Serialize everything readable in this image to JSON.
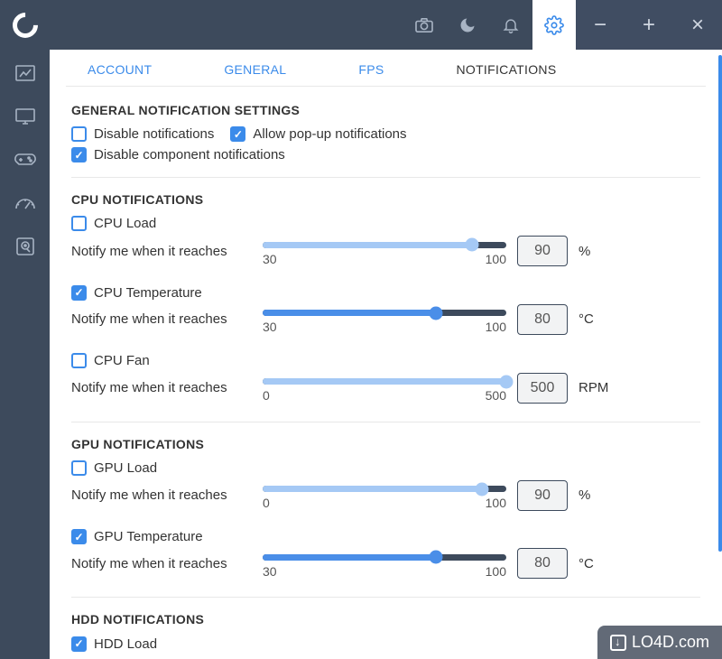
{
  "topbar": {
    "icons": [
      "camera-icon",
      "moon-icon",
      "bell-icon",
      "settings-icon"
    ]
  },
  "sidebar": {
    "icons": [
      "dashboard-icon",
      "monitor-icon",
      "gamepad-icon",
      "gauge-icon",
      "disk-icon"
    ]
  },
  "tabs": [
    {
      "label": "ACCOUNT",
      "active": false
    },
    {
      "label": "GENERAL",
      "active": false
    },
    {
      "label": "FPS",
      "active": false
    },
    {
      "label": "NOTIFICATIONS",
      "active": true
    }
  ],
  "sections": {
    "general": {
      "heading": "GENERAL NOTIFICATION SETTINGS",
      "checks": [
        {
          "label": "Disable notifications",
          "checked": false
        },
        {
          "label": "Allow pop-up notifications",
          "checked": true
        },
        {
          "label": "Disable component notifications",
          "checked": true
        }
      ]
    },
    "cpu": {
      "heading": "CPU NOTIFICATIONS",
      "items": [
        {
          "label": "CPU Load",
          "checked": false,
          "notify": "Notify me when it reaches",
          "min": "30",
          "max": "100",
          "value": "90",
          "unit": "%",
          "fill": 86,
          "mode": "light"
        },
        {
          "label": "CPU Temperature",
          "checked": true,
          "notify": "Notify me when it reaches",
          "min": "30",
          "max": "100",
          "value": "80",
          "unit": "°C",
          "fill": 71,
          "mode": "blue"
        },
        {
          "label": "CPU Fan",
          "checked": false,
          "notify": "Notify me when it reaches",
          "min": "0",
          "max": "500",
          "value": "500",
          "unit": "RPM",
          "fill": 100,
          "mode": "light"
        }
      ]
    },
    "gpu": {
      "heading": "GPU NOTIFICATIONS",
      "items": [
        {
          "label": "GPU Load",
          "checked": false,
          "notify": "Notify me when it reaches",
          "min": "0",
          "max": "100",
          "value": "90",
          "unit": "%",
          "fill": 90,
          "mode": "light"
        },
        {
          "label": "GPU Temperature",
          "checked": true,
          "notify": "Notify me when it reaches",
          "min": "30",
          "max": "100",
          "value": "80",
          "unit": "°C",
          "fill": 71,
          "mode": "blue"
        }
      ]
    },
    "hdd": {
      "heading": "HDD NOTIFICATIONS",
      "items": [
        {
          "label": "HDD Load",
          "checked": true
        }
      ]
    }
  },
  "watermark": "LO4D.com"
}
